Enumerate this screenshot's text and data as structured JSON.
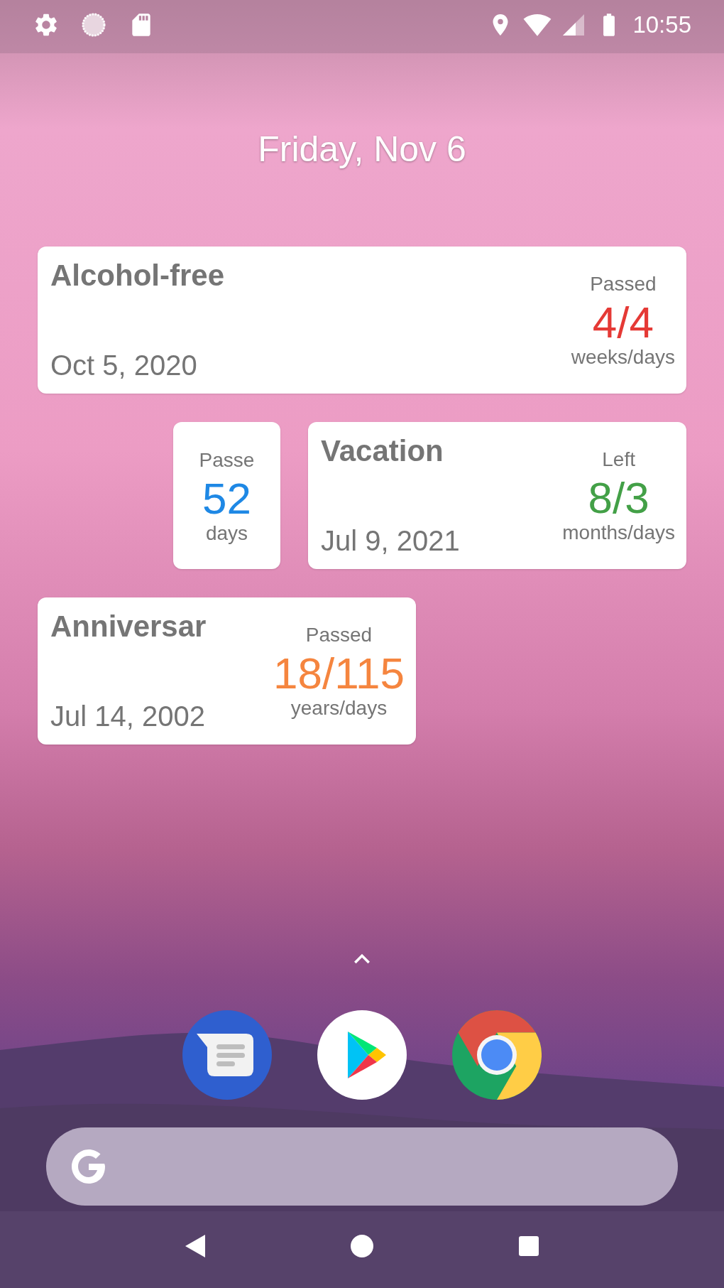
{
  "status_bar": {
    "time": "10:55"
  },
  "date": "Friday, Nov 6",
  "widget_rows": [
    [
      {
        "kind": "wide",
        "title": "Alcohol-free",
        "date": "Oct 5, 2020",
        "label": "Passed",
        "value": "4/4",
        "unit": "weeks/days",
        "color": "#e53935"
      }
    ],
    [
      {
        "kind": "small",
        "label": "Passe",
        "value": "52",
        "unit": "days",
        "color": "#1e88e5"
      },
      {
        "kind": "medium",
        "title": "Vacation",
        "date": "Jul 9, 2021",
        "label": "Left",
        "value": "8/3",
        "unit": "months/days",
        "color": "#43a047"
      }
    ],
    [
      {
        "kind": "medium",
        "title": "Anniversar",
        "date": "Jul 14, 2002",
        "label": "Passed",
        "value": "18/115",
        "unit": "years/days",
        "color": "#f5853f"
      }
    ]
  ]
}
